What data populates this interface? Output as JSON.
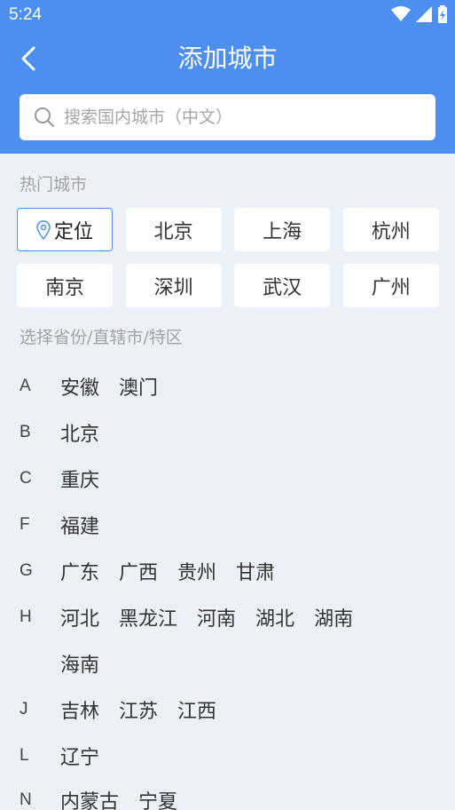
{
  "status": {
    "time": "5:24"
  },
  "header": {
    "title": "添加城市"
  },
  "search": {
    "placeholder": "搜索国内城市（中文）"
  },
  "hot": {
    "label": "热门城市",
    "locate_label": "定位",
    "cities": [
      "北京",
      "上海",
      "杭州",
      "南京",
      "深圳",
      "武汉",
      "广州"
    ]
  },
  "provinces": {
    "label": "选择省份/直辖市/特区",
    "groups": [
      {
        "letter": "A",
        "items": [
          "安徽",
          "澳门"
        ]
      },
      {
        "letter": "B",
        "items": [
          "北京"
        ]
      },
      {
        "letter": "C",
        "items": [
          "重庆"
        ]
      },
      {
        "letter": "F",
        "items": [
          "福建"
        ]
      },
      {
        "letter": "G",
        "items": [
          "广东",
          "广西",
          "贵州",
          "甘肃"
        ]
      },
      {
        "letter": "H",
        "items": [
          "河北",
          "黑龙江",
          "河南",
          "湖北",
          "湖南"
        ]
      },
      {
        "letter": "",
        "items": [
          "海南"
        ]
      },
      {
        "letter": "J",
        "items": [
          "吉林",
          "江苏",
          "江西"
        ]
      },
      {
        "letter": "L",
        "items": [
          "辽宁"
        ]
      },
      {
        "letter": "N",
        "items": [
          "内蒙古",
          "宁夏"
        ]
      }
    ]
  },
  "colors": {
    "accent": "#4d8ff0",
    "background": "#ebf1f7"
  },
  "icons": {
    "back": "chevron-left-icon",
    "search": "search-icon",
    "locate": "location-pin-icon"
  }
}
